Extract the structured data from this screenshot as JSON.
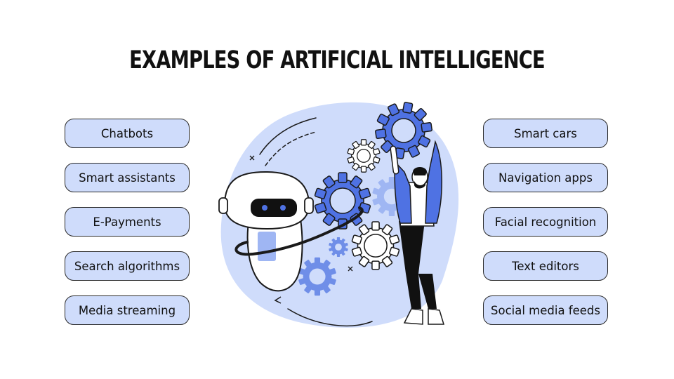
{
  "title": "EXAMPLES OF ARTIFICIAL INTELLIGENCE",
  "left_items": [
    "Chatbots",
    "Smart assistants",
    "E-Payments",
    "Search algorithms",
    "Media streaming"
  ],
  "right_items": [
    "Smart cars",
    "Navigation apps",
    "Facial recognition",
    "Text editors",
    "Social media feeds"
  ],
  "colors": {
    "pill_fill": "#cfdcfb",
    "blob": "#cfdcfb",
    "gear_blue": "#4f72e3",
    "outline": "#1a1a1a"
  },
  "illustration": {
    "icons": [
      "robot-icon",
      "gear-icon",
      "person-icon"
    ]
  }
}
